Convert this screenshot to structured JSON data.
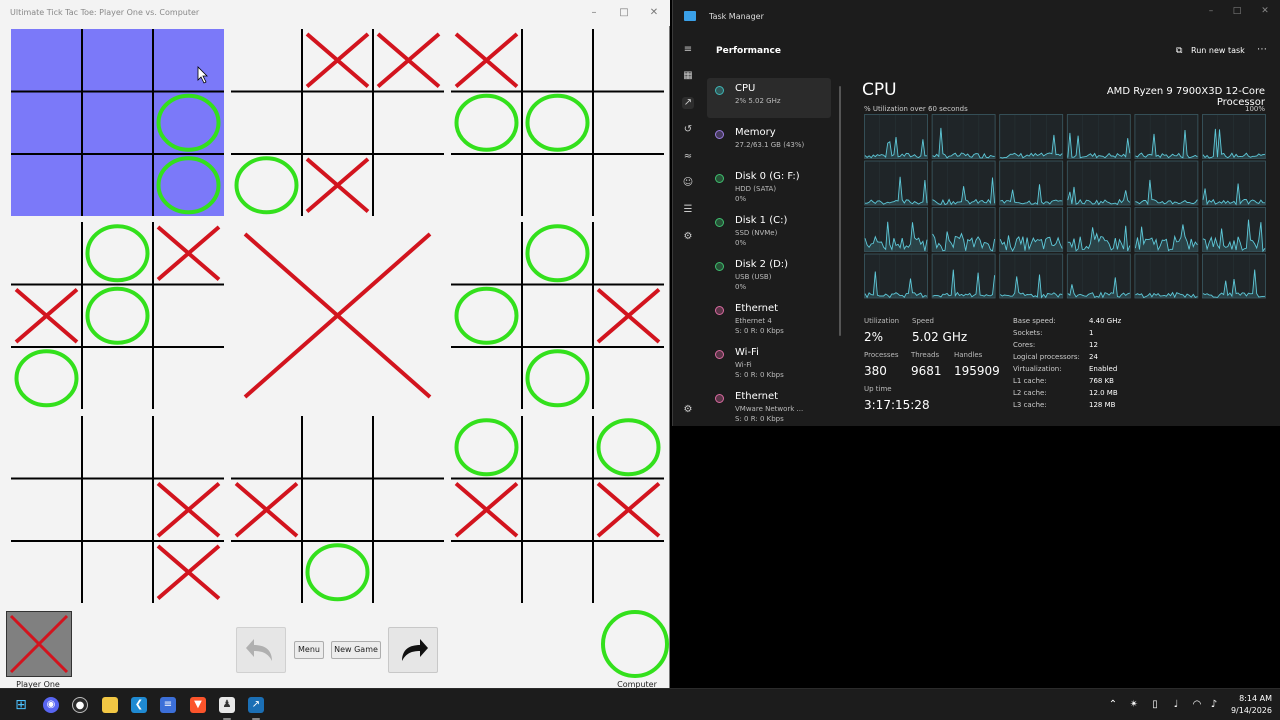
{
  "game": {
    "window_title": "Ultimate Tick Tac Toe: Player One vs. Computer",
    "highlighted_board": 0,
    "boards": [
      {
        "cells": [
          "",
          "",
          "",
          "",
          "",
          "O",
          "",
          "",
          "O"
        ]
      },
      {
        "cells": [
          "",
          "X",
          "X",
          "",
          "",
          "",
          "O",
          "X",
          ""
        ]
      },
      {
        "cells": [
          "X",
          "",
          "",
          "O",
          "O",
          "",
          "",
          "",
          ""
        ]
      },
      {
        "cells": [
          "",
          "O",
          "X",
          "X",
          "O",
          "",
          "O",
          "",
          ""
        ]
      },
      {
        "cells": [
          "",
          "",
          "",
          "",
          "",
          "",
          "",
          "",
          ""
        ],
        "winner": "X"
      },
      {
        "cells": [
          "",
          "O",
          "",
          "O",
          "",
          "X",
          "",
          "O",
          ""
        ]
      },
      {
        "cells": [
          "",
          "",
          "",
          "",
          "",
          "X",
          "",
          "",
          "X"
        ]
      },
      {
        "cells": [
          "",
          "",
          "",
          "X",
          "",
          "",
          "",
          "O",
          ""
        ]
      },
      {
        "cells": [
          "O",
          "",
          "O",
          "X",
          "",
          "X",
          "",
          "",
          ""
        ]
      }
    ],
    "player_one_label": "Player One",
    "computer_label": "Computer",
    "menu_label": "Menu",
    "new_game_label": "New Game",
    "colors": {
      "x": "#d2141e",
      "o": "#33e01c",
      "highlight": "#7b79f9",
      "grid": "#000000"
    }
  },
  "taskmanager": {
    "title": "Task Manager",
    "section": "Performance",
    "run_new_task": "Run new task",
    "resources": [
      {
        "name": "CPU",
        "sub": [
          "2% 5.02 GHz"
        ],
        "color": "#3fb6b6"
      },
      {
        "name": "Memory",
        "sub": [
          "27.2/63.1 GB (43%)"
        ],
        "color": "#9b7ce0"
      },
      {
        "name": "Disk 0 (G: F:)",
        "sub": [
          "HDD (SATA)",
          "0%"
        ],
        "color": "#3fbf6f"
      },
      {
        "name": "Disk 1 (C:)",
        "sub": [
          "SSD (NVMe)",
          "0%"
        ],
        "color": "#3fbf6f"
      },
      {
        "name": "Disk 2 (D:)",
        "sub": [
          "USB (USB)",
          "0%"
        ],
        "color": "#3fbf6f"
      },
      {
        "name": "Ethernet",
        "sub": [
          "Ethernet 4",
          "S: 0 R: 0 Kbps"
        ],
        "color": "#d86aa0"
      },
      {
        "name": "Wi-Fi",
        "sub": [
          "Wi-Fi",
          "S: 0 R: 0 Kbps"
        ],
        "color": "#d86aa0"
      },
      {
        "name": "Ethernet",
        "sub": [
          "VMware Network ...",
          "S: 0 R: 0 Kbps"
        ],
        "color": "#d86aa0"
      },
      {
        "name": "Ethernet",
        "sub": [],
        "color": "#d86aa0"
      }
    ],
    "cpu_title": "CPU",
    "cpu_model": "AMD Ryzen 9 7900X3D 12-Core Processor",
    "graph_caption": "% Utilization over 60 seconds",
    "graph_max": "100%",
    "graph_color": "#5ec8d8",
    "stats": {
      "utilization_label": "Utilization",
      "utilization": "2%",
      "speed_label": "Speed",
      "speed": "5.02 GHz",
      "processes_label": "Processes",
      "processes": "380",
      "threads_label": "Threads",
      "threads": "9681",
      "handles_label": "Handles",
      "handles": "195909",
      "uptime_label": "Up time",
      "uptime": "3:17:15:28"
    },
    "specs": [
      {
        "label": "Base speed:",
        "value": "4.40 GHz"
      },
      {
        "label": "Sockets:",
        "value": "1"
      },
      {
        "label": "Cores:",
        "value": "12"
      },
      {
        "label": "Logical processors:",
        "value": "24"
      },
      {
        "label": "Virtualization:",
        "value": "Enabled"
      },
      {
        "label": "L1 cache:",
        "value": "768 KB"
      },
      {
        "label": "L2 cache:",
        "value": "12.0 MB"
      },
      {
        "label": "L3 cache:",
        "value": "128 MB"
      }
    ]
  },
  "taskbar": {
    "time": "8:14 AM",
    "date": "9/14/2026",
    "apps": [
      "start-icon",
      "discord-icon",
      "password-manager-icon",
      "file-explorer-icon",
      "vscode-icon",
      "notes-icon",
      "brave-icon",
      "game-icon",
      "task-manager-icon"
    ]
  }
}
